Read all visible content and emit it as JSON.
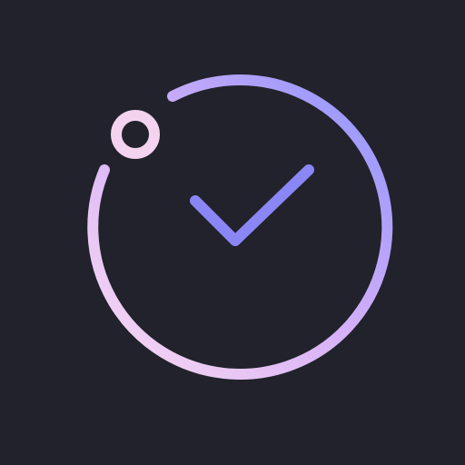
{
  "icon": {
    "name": "timer-check-icon",
    "colors": {
      "background": "#21222b",
      "gradient_start": "#f9dcf1",
      "gradient_mid": "#d6b0f8",
      "gradient_end": "#8c93fc",
      "checkmark": "#8a86f6",
      "knob": "#f4d3ef"
    }
  }
}
